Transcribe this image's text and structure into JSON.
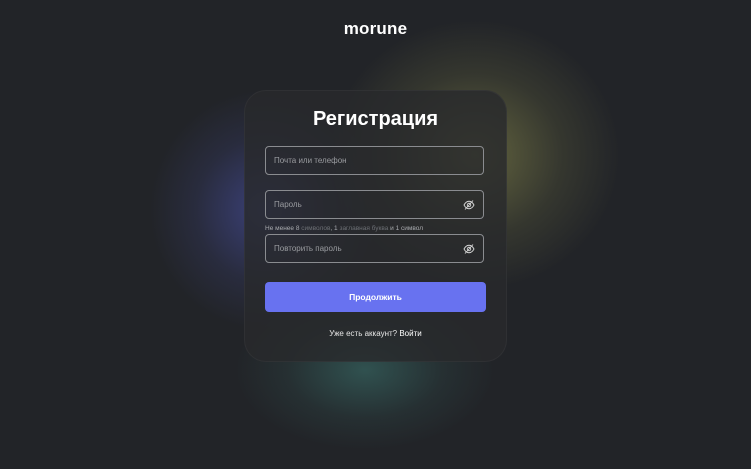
{
  "brand": {
    "logo_text": "morune"
  },
  "form": {
    "title": "Регистрация",
    "email": {
      "placeholder": "Почта или телефон",
      "value": ""
    },
    "password": {
      "placeholder": "Пароль",
      "value": "",
      "toggle_icon": "eye-off-icon"
    },
    "password_hint": {
      "prefix": "Не менее ",
      "min_chars": "8",
      "chars_word": " символов",
      "sep1": ", ",
      "min_upper": "1",
      "upper_word": " заглавная буква",
      "sep2": " и ",
      "min_symbol": "1 символ"
    },
    "confirm": {
      "placeholder": "Повторить пароль",
      "value": "",
      "toggle_icon": "eye-off-icon"
    },
    "submit_label": "Продолжить",
    "signin_prompt": "Уже есть аккаунт?",
    "signin_link": "Войти"
  },
  "colors": {
    "background": "#222428",
    "card": "#2a2c2e",
    "accent": "#6872f0",
    "glow_blue": "#5a64dc",
    "glow_yellow": "#bebe5f",
    "glow_teal": "#46968c"
  }
}
